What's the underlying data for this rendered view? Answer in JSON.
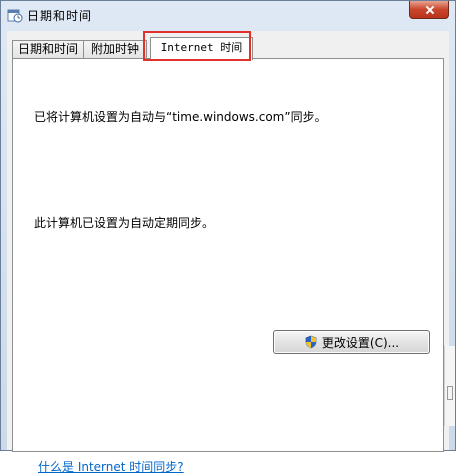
{
  "window": {
    "title": "日期和时间",
    "icon": "clock-calendar-icon"
  },
  "tabs": [
    {
      "label": "日期和时间",
      "active": false
    },
    {
      "label": "附加时钟",
      "active": false
    },
    {
      "label": "Internet 时间",
      "active": true,
      "highlighted": true
    }
  ],
  "content": {
    "sync_status": "已将计算机设置为自动与“time.windows.com”同步。",
    "schedule_status": "此计算机已设置为自动定期同步。",
    "change_settings_label": "更改设置(C)...",
    "change_settings_icon": "uac-shield-icon",
    "help_link": "什么是 Internet 时间同步?"
  },
  "colors": {
    "highlight": "#e0322a",
    "link": "#0066cc"
  }
}
